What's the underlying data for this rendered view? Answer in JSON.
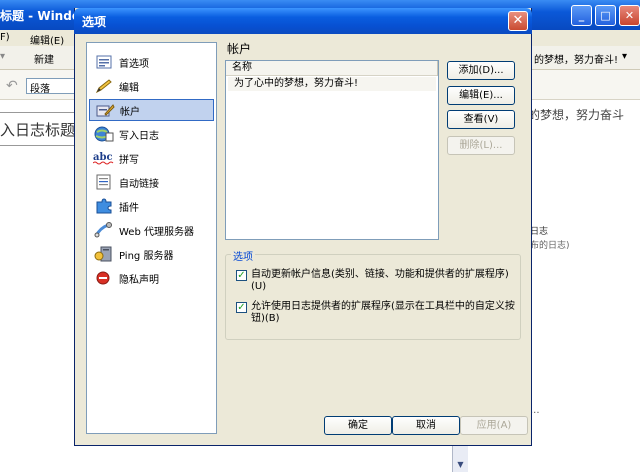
{
  "background": {
    "title": "标题 - Windo",
    "menu": [
      "F)",
      "编辑(E)"
    ],
    "toolbar_new": "新建",
    "toolbar_right": "的梦想，努力奋斗!",
    "format_select": "段落",
    "title_field": "入日志标题",
    "right_text": "的梦想，努力奋斗",
    "blog_label": "日志",
    "blog_sub": "布的日志)",
    "dots": "..."
  },
  "dialog": {
    "title": "选项",
    "close_symbol": "✕",
    "nav": [
      {
        "label": "首选项",
        "icon": "preferences-icon"
      },
      {
        "label": "编辑",
        "icon": "pencil-icon"
      },
      {
        "label": "帐户",
        "icon": "account-icon",
        "selected": true
      },
      {
        "label": "写入日志",
        "icon": "globe-write-icon"
      },
      {
        "label": "拼写",
        "icon": "spelling-abc-icon"
      },
      {
        "label": "自动链接",
        "icon": "auto-link-icon"
      },
      {
        "label": "插件",
        "icon": "puzzle-plugin-icon"
      },
      {
        "label": "Web 代理服务器",
        "icon": "proxy-server-icon"
      },
      {
        "label": "Ping 服务器",
        "icon": "ping-server-icon"
      },
      {
        "label": "隐私声明",
        "icon": "privacy-icon"
      }
    ],
    "heading": "帐户",
    "list": {
      "column": "名称",
      "rows": [
        "为了心中的梦想，努力奋斗!"
      ]
    },
    "buttons": {
      "add": "添加(D)...",
      "edit": "编辑(E)...",
      "view": "查看(V)",
      "delete": "删除(L)..."
    },
    "options": {
      "legend": "选项",
      "items": [
        {
          "label": "自动更新帐户信息(类别、链接、功能和提供者的扩展程序)(U)",
          "checked": true
        },
        {
          "label": "允许使用日志提供者的扩展程序(显示在工具栏中的自定义按钮)(B)",
          "checked": true
        }
      ]
    },
    "footer": {
      "ok": "确定",
      "cancel": "取消",
      "apply": "应用(A)"
    }
  }
}
